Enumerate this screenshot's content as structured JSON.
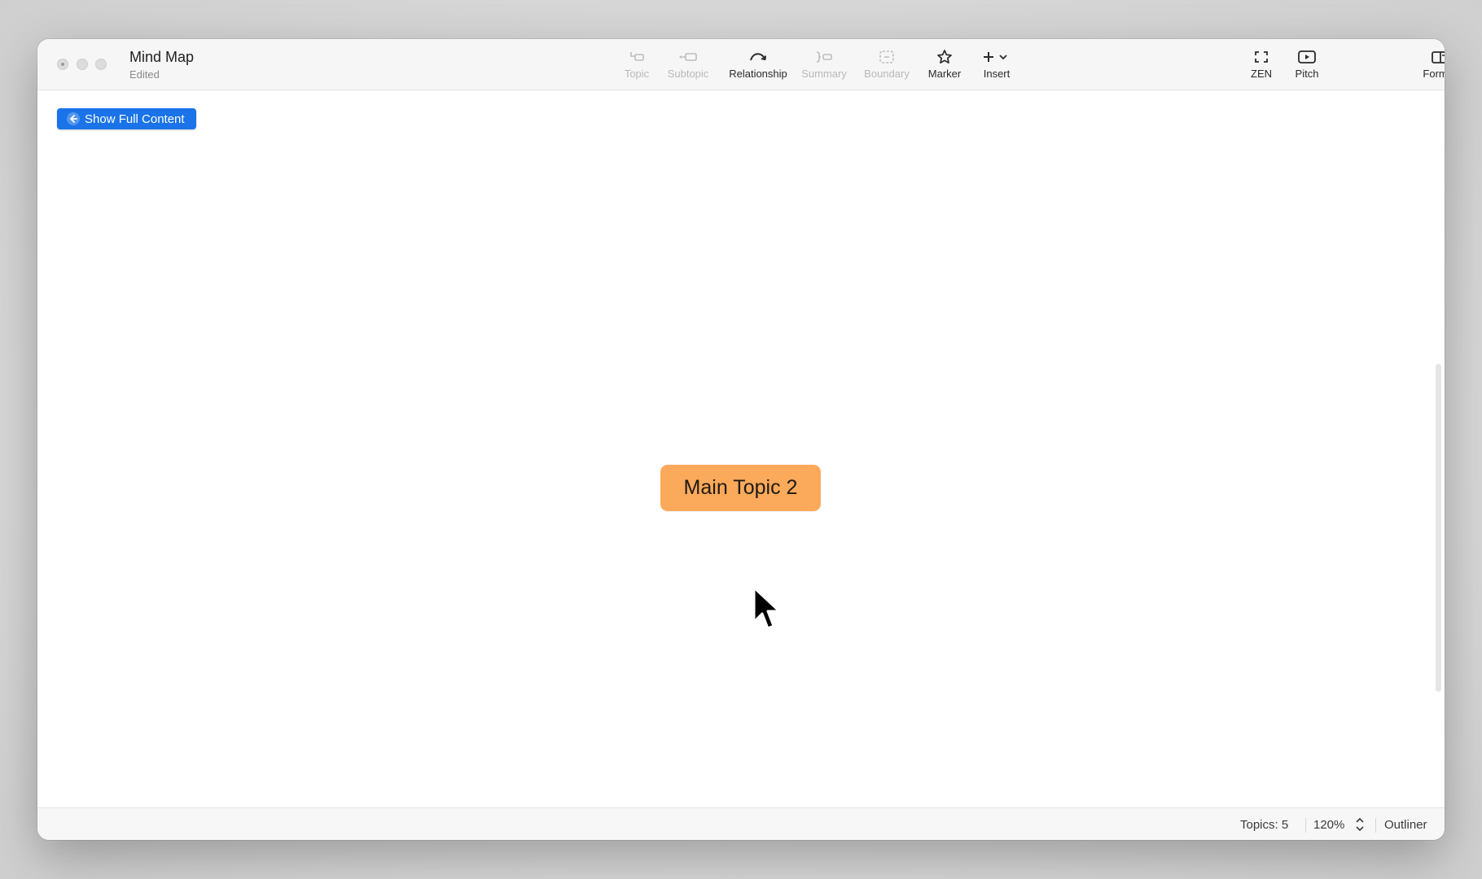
{
  "window": {
    "title": "Mind Map",
    "subtitle": "Edited"
  },
  "toolbar": {
    "topic_label": "Topic",
    "subtopic_label": "Subtopic",
    "relationship_label": "Relationship",
    "summary_label": "Summary",
    "boundary_label": "Boundary",
    "marker_label": "Marker",
    "insert_label": "Insert",
    "zen_label": "ZEN",
    "pitch_label": "Pitch",
    "format_label": "Format"
  },
  "canvas": {
    "show_full_content_label": "Show Full Content",
    "topic_node_text": "Main Topic 2",
    "topic_node_color": "#fba95a"
  },
  "statusbar": {
    "topics_count": "Topics: 5",
    "zoom_level": "120%",
    "outliner_label": "Outliner"
  },
  "colors": {
    "accent": "#1a73e8"
  }
}
